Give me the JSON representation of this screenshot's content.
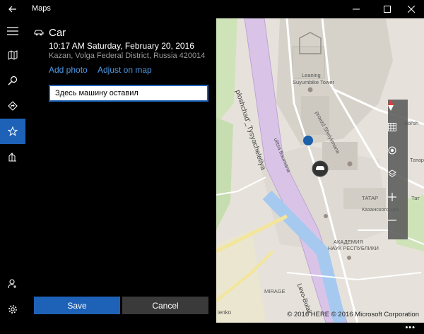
{
  "window": {
    "title": "Maps"
  },
  "nav": {
    "items": [
      {
        "icon": "hamburger-menu-icon"
      },
      {
        "icon": "map-icon"
      },
      {
        "icon": "search-icon"
      },
      {
        "icon": "directions-icon"
      },
      {
        "icon": "favorites-star-icon"
      },
      {
        "icon": "3d-cities-icon"
      },
      {
        "icon": "sign-in-person-icon"
      },
      {
        "icon": "settings-gear-icon"
      }
    ],
    "active": "favorites-star-icon"
  },
  "detail": {
    "title": "Car",
    "datetime": "10:17 AM Saturday, February 20, 2016",
    "address": "Kazan, Volga Federal District, Russia 420014",
    "add_photo_label": "Add photo",
    "adjust_label": "Adjust on map",
    "note_value": "Здесь машину оставил",
    "save_label": "Save",
    "cancel_label": "Cancel"
  },
  "map": {
    "labels": {
      "tysyacheletiya": "ploshchad'_Tysyacheletiya",
      "shelyakmana": "proezd Shelykmana",
      "baumana": "ulitsa Baumana",
      "leaning": "Leaning",
      "suyumbike": "Suyumbike Tower",
      "bolsh": "Bol'sh",
      "levo": "Levo-Bulak",
      "mirage": "MIRAGE",
      "akademiya1": "АКАДЕМИЯ",
      "akademiya2": "НАУК РЕСПУБЛИКИ",
      "tatar1": "Татар",
      "tatar2": "ТАТАР",
      "kazan": "Казанского кре",
      "kazan2": "Тат",
      "enko": "ienko"
    },
    "copyright": "© 2016 HERE © 2016 Microsoft Corporation",
    "controls": [
      "compass-icon",
      "map-layers-grid-icon",
      "locate-me-icon",
      "map-style-icon",
      "zoom-in-icon",
      "zoom-out-icon"
    ]
  },
  "colors": {
    "accent": "#1e62b8",
    "link": "#4f9ae6",
    "road_highlight": "#d9c4e8",
    "water": "#a6c9f0",
    "park": "#cfe3b8"
  }
}
